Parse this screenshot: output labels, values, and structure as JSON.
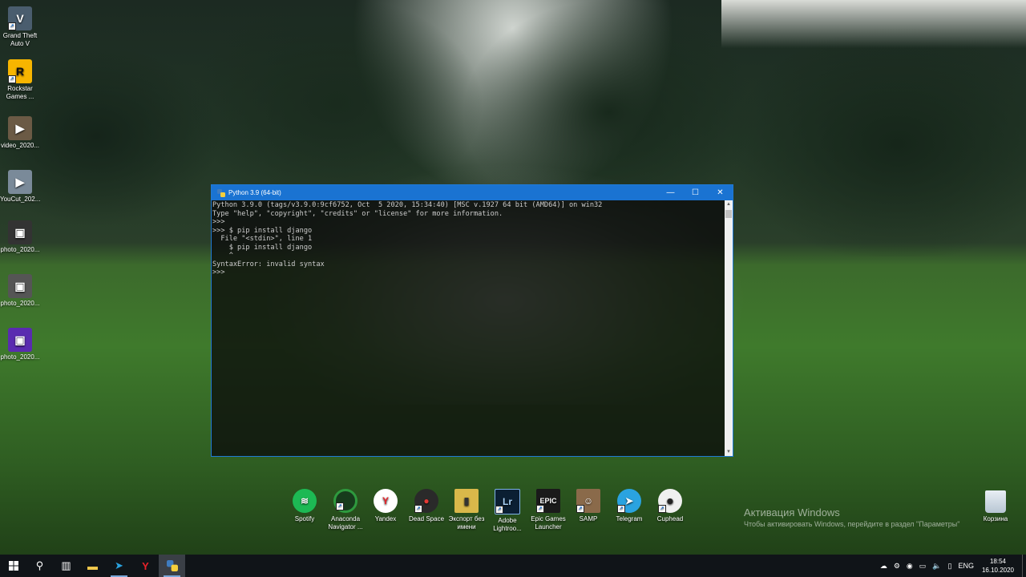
{
  "desktop": {
    "icons": [
      {
        "label": "Grand Theft Auto V",
        "icon": "gta-icon",
        "color": "#4a5d6e"
      },
      {
        "label": "Rockstar Games ...",
        "icon": "rockstar-icon",
        "color": "#f7b500"
      },
      {
        "label": "video_2020...",
        "icon": "video-thumbnail-icon",
        "color": "#6b5a45"
      },
      {
        "label": "YouCut_202...",
        "icon": "video-thumbnail-icon",
        "color": "#7a8a99"
      },
      {
        "label": "photo_2020...",
        "icon": "photo-thumbnail-icon",
        "color": "#333333"
      },
      {
        "label": "photo_2020...",
        "icon": "photo-thumbnail-icon",
        "color": "#555555"
      },
      {
        "label": "photo_2020...",
        "icon": "photo-thumbnail-icon",
        "color": "#5a2bb0"
      }
    ]
  },
  "python_window": {
    "title": "Python 3.9 (64-bit)",
    "minimize": "—",
    "maximize": "☐",
    "close": "✕",
    "console_lines": [
      "Python 3.9.0 (tags/v3.9.0:9cf6752, Oct  5 2020, 15:34:40) [MSC v.1927 64 bit (AMD64)] on win32",
      "Type \"help\", \"copyright\", \"credits\" or \"license\" for more information.",
      ">>>",
      ">>> $ pip install django",
      "  File \"<stdin>\", line 1",
      "    $ pip install django",
      "    ^",
      "SyntaxError: invalid syntax",
      ">>>"
    ]
  },
  "dock": [
    {
      "label": "Spotify",
      "color": "#1db954",
      "glyph": "≋"
    },
    {
      "label": "Anaconda Navigator ...",
      "color": "#2e9a3e",
      "glyph": "◌"
    },
    {
      "label": "Yandex",
      "color": "#ffffff",
      "glyph": "Y"
    },
    {
      "label": "Dead Space",
      "color": "#2a2a2a",
      "glyph": "●"
    },
    {
      "label": "Экспорт без имени",
      "color": "#d9b84a",
      "glyph": "▮"
    },
    {
      "label": "Adobe Lightroo...",
      "color": "#0b1f33",
      "glyph": "Lr"
    },
    {
      "label": "Epic Games Launcher",
      "color": "#1a1a1a",
      "glyph": "EPIC"
    },
    {
      "label": "SAMP",
      "color": "#8a6a4a",
      "glyph": "☺"
    },
    {
      "label": "Telegram",
      "color": "#2aa3e0",
      "glyph": "➤"
    },
    {
      "label": "Cuphead",
      "color": "#f0f0f0",
      "glyph": "☻"
    }
  ],
  "activation": {
    "title": "Активация Windows",
    "subtitle": "Чтобы активировать Windows, перейдите в раздел \"Параметры\""
  },
  "recycle_bin": {
    "label": "Корзина"
  },
  "taskbar": {
    "language": "ENG",
    "time": "18:54",
    "date": "16.10.2020"
  }
}
